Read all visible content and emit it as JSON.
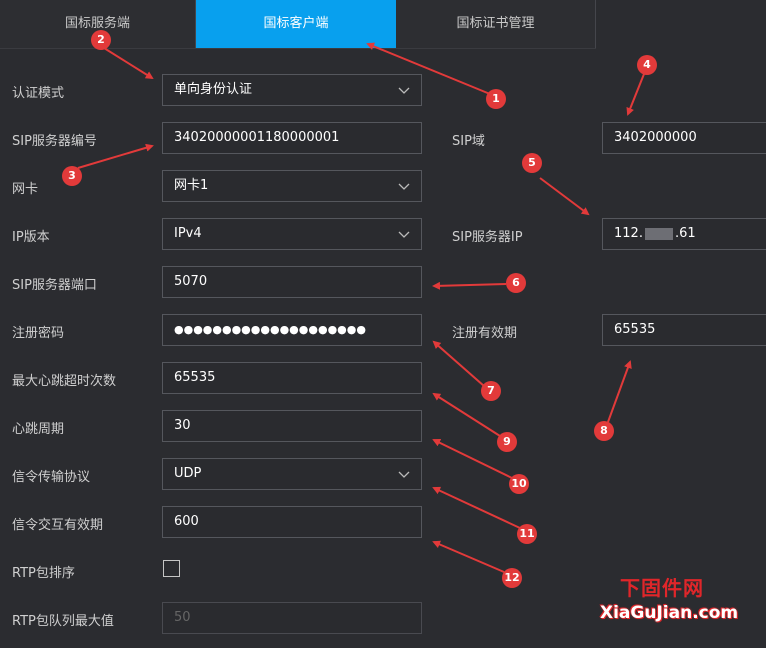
{
  "tabs": [
    {
      "label": "国标服务端"
    },
    {
      "label": "国标客户端"
    },
    {
      "label": "国标证书管理"
    }
  ],
  "form": {
    "auth_mode": {
      "label": "认证模式",
      "value": "单向身份认证"
    },
    "sip_server_id": {
      "label": "SIP服务器编号",
      "value": "34020000001180000001"
    },
    "sip_domain": {
      "label": "SIP域",
      "value": "3402000000"
    },
    "nic": {
      "label": "网卡",
      "value": "网卡1"
    },
    "ip_version": {
      "label": "IP版本",
      "value": "IPv4"
    },
    "sip_server_ip": {
      "label": "SIP服务器IP",
      "value_start": "112.",
      "value_end": ".61"
    },
    "sip_server_port": {
      "label": "SIP服务器端口",
      "value": "5070"
    },
    "register_password": {
      "label": "注册密码",
      "value": "●●●●●●●●●●●●●●●●●●●●"
    },
    "register_validity": {
      "label": "注册有效期",
      "value": "65535"
    },
    "max_heartbeat_timeouts": {
      "label": "最大心跳超时次数",
      "value": "65535"
    },
    "heartbeat_period": {
      "label": "心跳周期",
      "value": "30"
    },
    "signaling_protocol": {
      "label": "信令传输协议",
      "value": "UDP"
    },
    "signaling_validity": {
      "label": "信令交互有效期",
      "value": "600"
    },
    "rtp_sort": {
      "label": "RTP包排序",
      "checked": false
    },
    "rtp_queue_max": {
      "label": "RTP包队列最大值",
      "value": "50"
    }
  },
  "annotations": [
    "1",
    "2",
    "3",
    "4",
    "5",
    "6",
    "7",
    "8",
    "9",
    "10",
    "11",
    "12"
  ],
  "watermark": {
    "line1": "下固件网",
    "line2": "XiaGuJian.com"
  },
  "colors": {
    "accent": "#08a0ee",
    "annotation": "#e23a3a",
    "background": "#2b2c30"
  },
  "icons": {
    "dropdown": "chevron-down-icon"
  }
}
